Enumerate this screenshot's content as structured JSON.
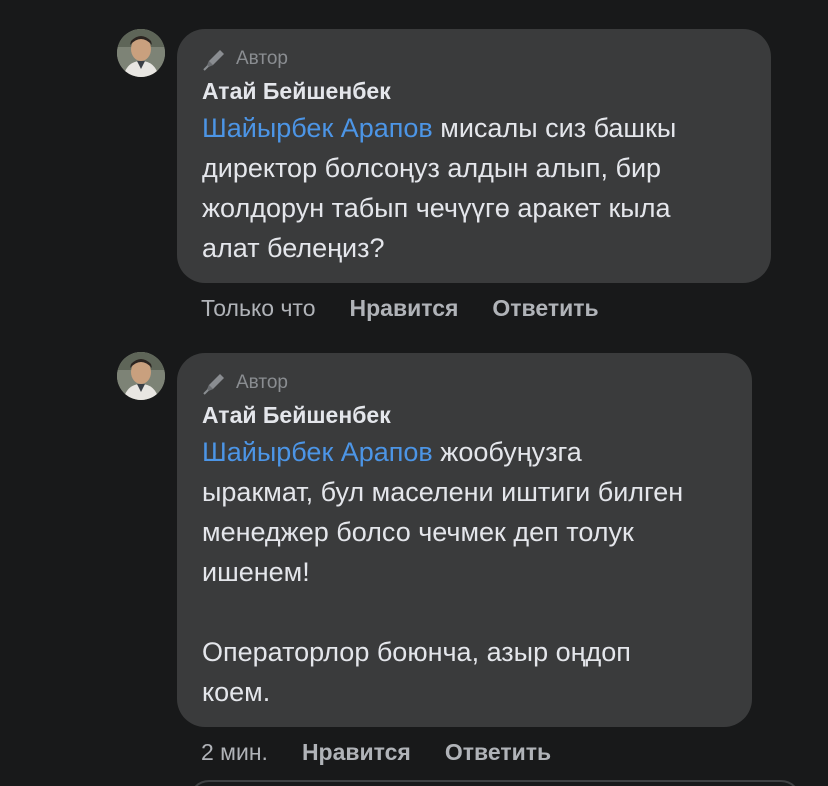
{
  "comments": [
    {
      "badge": "Автор",
      "author": "Атай Бейшенбек",
      "mention": "Шайырбек Арапов",
      "text_lines": [
        " мисалы сиз башкы",
        "директор болсоңуз алдын алып, бир",
        "жолдорун табып чечүүгө аракет кыла",
        "алат белеңиз?"
      ],
      "time": "Только что",
      "like_label": "Нравится",
      "reply_label": "Ответить"
    },
    {
      "badge": "Автор",
      "author": "Атай Бейшенбек",
      "mention": "Шайырбек Арапов",
      "text_lines": [
        " жообуңузга",
        "ыракмат, бул маселени иштиги билген",
        "менеджер болсо чечмек деп толук",
        "ишенем!",
        "",
        "Операторлор боюнча, азыр оңдоп",
        "коем."
      ],
      "time": "2 мин.",
      "like_label": "Нравится",
      "reply_label": "Ответить"
    }
  ],
  "icons": {
    "badge_icon": "pen-icon",
    "avatar": "avatar"
  },
  "colors": {
    "background": "#18191a",
    "bubble": "#3a3b3c",
    "mention": "#4c95e6",
    "meta": "#b0b3b8"
  }
}
